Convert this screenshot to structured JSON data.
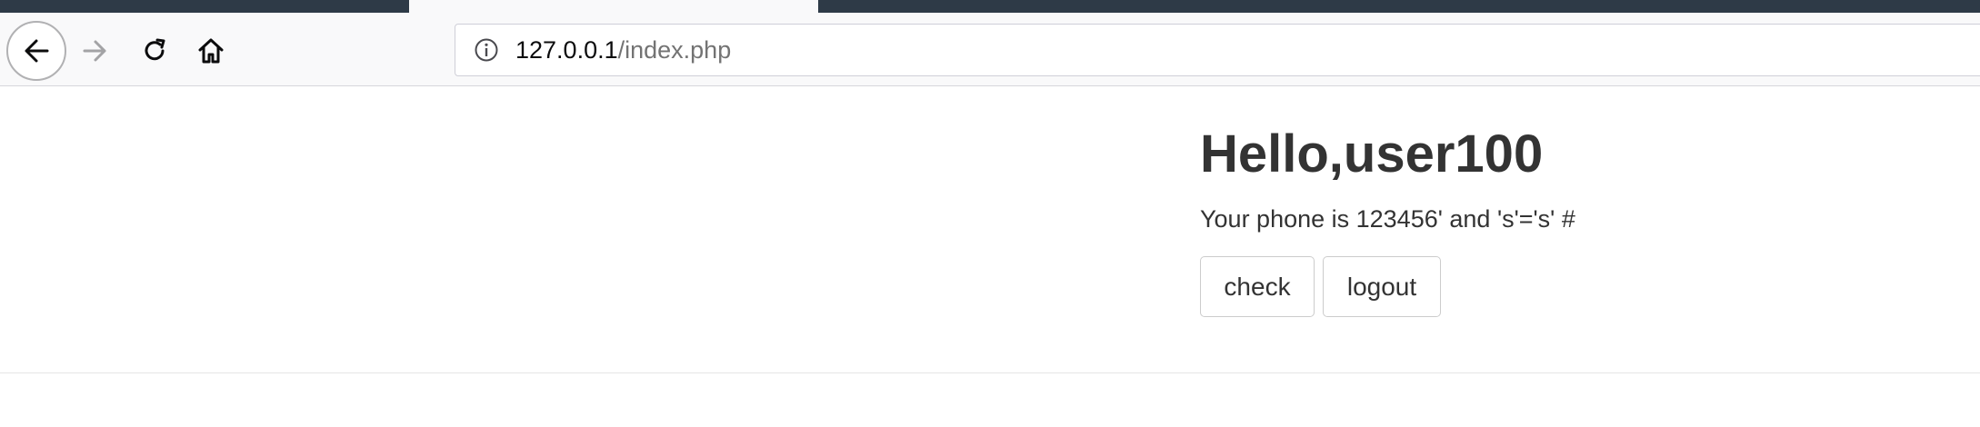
{
  "browser": {
    "url_host": "127.0.0.1",
    "url_path": "/index.php",
    "icons": {
      "back": "back-arrow-icon",
      "forward": "forward-arrow-icon",
      "reload": "reload-icon",
      "home": "home-icon",
      "info": "info-icon"
    }
  },
  "page": {
    "greeting": "Hello,user100",
    "phone_text": "Your phone is 123456' and 's'='s' #",
    "check_label": "check",
    "logout_label": "logout"
  },
  "colors": {
    "tabstrip": "#2e3a47",
    "heading_text": "#333333",
    "button_border": "#cccccc"
  }
}
